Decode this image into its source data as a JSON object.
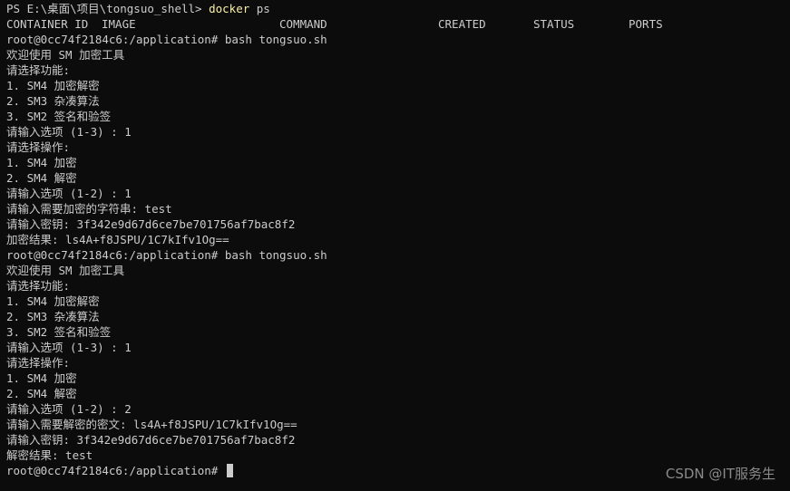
{
  "first_prompt": {
    "prefix": "PS E:\\桌面\\项目\\tongsuo_shell> ",
    "command": "docker",
    "args": " ps"
  },
  "ps_header": {
    "container_id": "CONTAINER ID",
    "image": "IMAGE",
    "command": "COMMAND",
    "created": "CREATED",
    "status": "STATUS",
    "ports": "PORTS"
  },
  "lines": [
    "root@0cc74f2184c6:/application# bash tongsuo.sh",
    "欢迎使用 SM 加密工具",
    "请选择功能:",
    "1. SM4 加密解密",
    "2. SM3 杂凑算法",
    "3. SM2 签名和验签",
    "请输入选项 (1-3) : 1",
    "请选择操作:",
    "1. SM4 加密",
    "2. SM4 解密",
    "请输入选项 (1-2) : 1",
    "请输入需要加密的字符串: test",
    "请输入密钥: 3f342e9d67d6ce7be701756af7bac8f2",
    "加密结果: ls4A+f8JSPU/1C7kIfv1Og==",
    "root@0cc74f2184c6:/application# bash tongsuo.sh",
    "欢迎使用 SM 加密工具",
    "请选择功能:",
    "1. SM4 加密解密",
    "2. SM3 杂凑算法",
    "3. SM2 签名和验签",
    "请输入选项 (1-3) : 1",
    "请选择操作:",
    "1. SM4 加密",
    "2. SM4 解密",
    "请输入选项 (1-2) : 2",
    "请输入需要解密的密文: ls4A+f8JSPU/1C7kIfv1Og==",
    "请输入密钥: 3f342e9d67d6ce7be701756af7bac8f2",
    "解密结果: test"
  ],
  "final_prompt": "root@0cc74f2184c6:/application# ",
  "watermark": "CSDN @IT服务生",
  "colors": {
    "background": "#0c0c0c",
    "text": "#cccccc",
    "command_highlight": "#f9f1a5"
  }
}
